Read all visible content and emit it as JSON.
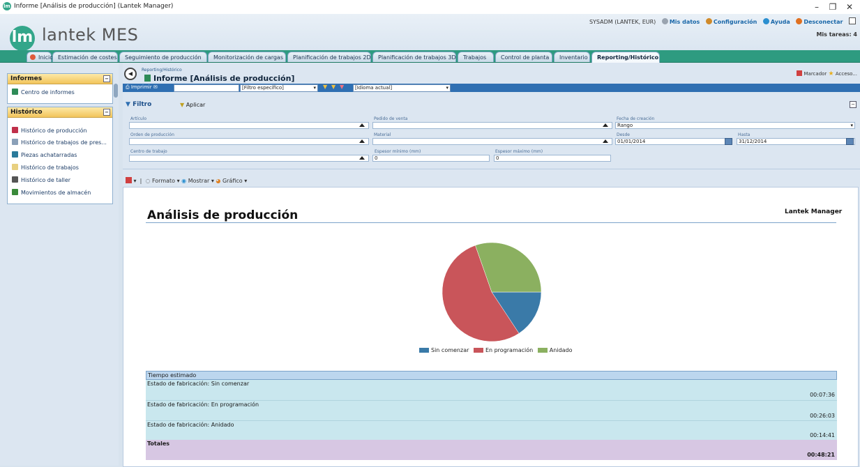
{
  "window": {
    "title": "Informe [Análisis de producción] (Lantek Manager)",
    "minimize": "–",
    "restore": "❐",
    "close": "✕"
  },
  "header": {
    "logo_mark": "lm",
    "logo_text": "lantek MES",
    "user": "SYSADM (LANTEK, EUR)",
    "links": [
      "Mis datos",
      "Configuración",
      "Ayuda",
      "Desconectar"
    ],
    "tasks": "Mis tareas: 4"
  },
  "tabs": [
    "Inicio",
    "Estimación de costes",
    "Seguimiento de producción",
    "Monitorización de cargas",
    "Planificación de trabajos 2D",
    "Planificación de trabajos 3D",
    "Trabajos",
    "Control de planta",
    "Inventario",
    "Reporting/Histórico"
  ],
  "active_tab": "Reporting/Histórico",
  "sidebar": {
    "informes": {
      "title": "Informes",
      "items": [
        "Centro de informes"
      ]
    },
    "historico": {
      "title": "Histórico",
      "items": [
        "Histórico de producción",
        "Histórico de trabajos de pres...",
        "Piezas achatarradas",
        "Histórico de trabajos",
        "Histórico de taller",
        "Movimientos de almacén"
      ]
    }
  },
  "main": {
    "breadcrumb": "Reporting/Histórico",
    "title": "Informe [Análisis de producción]",
    "marcador": "Marcador",
    "acceso": "Acceso...",
    "toolbar": {
      "print": "Imprimir",
      "filter_select": "[Filtro específico]",
      "language_select": "[Idioma actual]"
    },
    "filter": {
      "title": "Filtro",
      "apply": "Aplicar",
      "articulo": {
        "label": "Artículo",
        "value": ""
      },
      "pedido": {
        "label": "Pedido de venta",
        "value": ""
      },
      "fecha_creacion": {
        "label": "Fecha de creación",
        "value": "Rango"
      },
      "orden": {
        "label": "Orden de producción",
        "value": ""
      },
      "material": {
        "label": "Material",
        "value": ""
      },
      "desde": {
        "label": "Desde",
        "value": "01/01/2014"
      },
      "hasta": {
        "label": "Hasta",
        "value": "31/12/2014"
      },
      "centro": {
        "label": "Centro de trabajo",
        "value": ""
      },
      "esp_min": {
        "label": "Espesor mínimo (mm)",
        "value": "0"
      },
      "esp_max": {
        "label": "Espesor máximo (mm)",
        "value": "0"
      }
    },
    "subtoolbar": {
      "formato": "Formato",
      "mostrar": "Mostrar",
      "grafico": "Gráfico"
    },
    "report": {
      "title": "Análisis de producción",
      "brand": "Lantek Manager",
      "table": {
        "header": "Tiempo estimado",
        "rows": [
          {
            "label": "Estado de fabricación: Sin comenzar",
            "value": "00:07:36"
          },
          {
            "label": "Estado de fabricación: En programación",
            "value": "00:26:03"
          },
          {
            "label": "Estado de fabricación: Anidado",
            "value": "00:14:41"
          }
        ],
        "total_label": "Totales",
        "total_value": "00:48:21"
      }
    }
  },
  "colors": {
    "sin_comenzar": "#3a7aa8",
    "en_programacion": "#c9555a",
    "anidado": "#8bb060",
    "accent": "#2e9b80"
  },
  "chart_data": {
    "type": "pie",
    "categories": [
      "Sin comenzar",
      "En programación",
      "Anidado"
    ],
    "values": [
      456,
      1563,
      881
    ],
    "colors": [
      "#3a7aa8",
      "#c9555a",
      "#8bb060"
    ],
    "legend": "bottom"
  }
}
